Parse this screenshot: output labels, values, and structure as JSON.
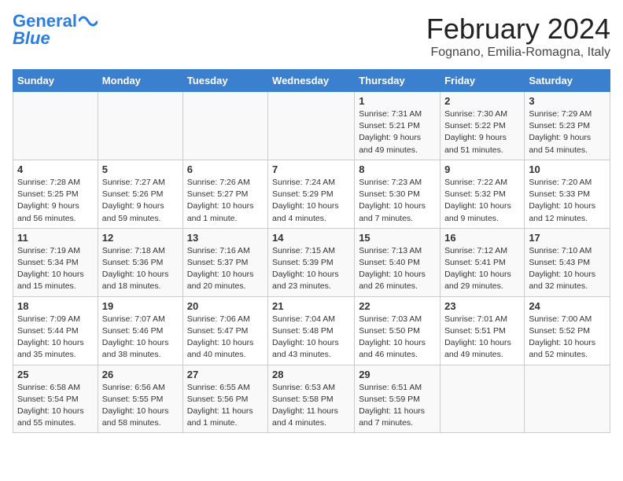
{
  "header": {
    "logo_line1": "General",
    "logo_line2": "Blue",
    "month_title": "February 2024",
    "location": "Fognano, Emilia-Romagna, Italy"
  },
  "days_of_week": [
    "Sunday",
    "Monday",
    "Tuesday",
    "Wednesday",
    "Thursday",
    "Friday",
    "Saturday"
  ],
  "weeks": [
    [
      {
        "day": "",
        "info": ""
      },
      {
        "day": "",
        "info": ""
      },
      {
        "day": "",
        "info": ""
      },
      {
        "day": "",
        "info": ""
      },
      {
        "day": "1",
        "info": "Sunrise: 7:31 AM\nSunset: 5:21 PM\nDaylight: 9 hours\nand 49 minutes."
      },
      {
        "day": "2",
        "info": "Sunrise: 7:30 AM\nSunset: 5:22 PM\nDaylight: 9 hours\nand 51 minutes."
      },
      {
        "day": "3",
        "info": "Sunrise: 7:29 AM\nSunset: 5:23 PM\nDaylight: 9 hours\nand 54 minutes."
      }
    ],
    [
      {
        "day": "4",
        "info": "Sunrise: 7:28 AM\nSunset: 5:25 PM\nDaylight: 9 hours\nand 56 minutes."
      },
      {
        "day": "5",
        "info": "Sunrise: 7:27 AM\nSunset: 5:26 PM\nDaylight: 9 hours\nand 59 minutes."
      },
      {
        "day": "6",
        "info": "Sunrise: 7:26 AM\nSunset: 5:27 PM\nDaylight: 10 hours\nand 1 minute."
      },
      {
        "day": "7",
        "info": "Sunrise: 7:24 AM\nSunset: 5:29 PM\nDaylight: 10 hours\nand 4 minutes."
      },
      {
        "day": "8",
        "info": "Sunrise: 7:23 AM\nSunset: 5:30 PM\nDaylight: 10 hours\nand 7 minutes."
      },
      {
        "day": "9",
        "info": "Sunrise: 7:22 AM\nSunset: 5:32 PM\nDaylight: 10 hours\nand 9 minutes."
      },
      {
        "day": "10",
        "info": "Sunrise: 7:20 AM\nSunset: 5:33 PM\nDaylight: 10 hours\nand 12 minutes."
      }
    ],
    [
      {
        "day": "11",
        "info": "Sunrise: 7:19 AM\nSunset: 5:34 PM\nDaylight: 10 hours\nand 15 minutes."
      },
      {
        "day": "12",
        "info": "Sunrise: 7:18 AM\nSunset: 5:36 PM\nDaylight: 10 hours\nand 18 minutes."
      },
      {
        "day": "13",
        "info": "Sunrise: 7:16 AM\nSunset: 5:37 PM\nDaylight: 10 hours\nand 20 minutes."
      },
      {
        "day": "14",
        "info": "Sunrise: 7:15 AM\nSunset: 5:39 PM\nDaylight: 10 hours\nand 23 minutes."
      },
      {
        "day": "15",
        "info": "Sunrise: 7:13 AM\nSunset: 5:40 PM\nDaylight: 10 hours\nand 26 minutes."
      },
      {
        "day": "16",
        "info": "Sunrise: 7:12 AM\nSunset: 5:41 PM\nDaylight: 10 hours\nand 29 minutes."
      },
      {
        "day": "17",
        "info": "Sunrise: 7:10 AM\nSunset: 5:43 PM\nDaylight: 10 hours\nand 32 minutes."
      }
    ],
    [
      {
        "day": "18",
        "info": "Sunrise: 7:09 AM\nSunset: 5:44 PM\nDaylight: 10 hours\nand 35 minutes."
      },
      {
        "day": "19",
        "info": "Sunrise: 7:07 AM\nSunset: 5:46 PM\nDaylight: 10 hours\nand 38 minutes."
      },
      {
        "day": "20",
        "info": "Sunrise: 7:06 AM\nSunset: 5:47 PM\nDaylight: 10 hours\nand 40 minutes."
      },
      {
        "day": "21",
        "info": "Sunrise: 7:04 AM\nSunset: 5:48 PM\nDaylight: 10 hours\nand 43 minutes."
      },
      {
        "day": "22",
        "info": "Sunrise: 7:03 AM\nSunset: 5:50 PM\nDaylight: 10 hours\nand 46 minutes."
      },
      {
        "day": "23",
        "info": "Sunrise: 7:01 AM\nSunset: 5:51 PM\nDaylight: 10 hours\nand 49 minutes."
      },
      {
        "day": "24",
        "info": "Sunrise: 7:00 AM\nSunset: 5:52 PM\nDaylight: 10 hours\nand 52 minutes."
      }
    ],
    [
      {
        "day": "25",
        "info": "Sunrise: 6:58 AM\nSunset: 5:54 PM\nDaylight: 10 hours\nand 55 minutes."
      },
      {
        "day": "26",
        "info": "Sunrise: 6:56 AM\nSunset: 5:55 PM\nDaylight: 10 hours\nand 58 minutes."
      },
      {
        "day": "27",
        "info": "Sunrise: 6:55 AM\nSunset: 5:56 PM\nDaylight: 11 hours\nand 1 minute."
      },
      {
        "day": "28",
        "info": "Sunrise: 6:53 AM\nSunset: 5:58 PM\nDaylight: 11 hours\nand 4 minutes."
      },
      {
        "day": "29",
        "info": "Sunrise: 6:51 AM\nSunset: 5:59 PM\nDaylight: 11 hours\nand 7 minutes."
      },
      {
        "day": "",
        "info": ""
      },
      {
        "day": "",
        "info": ""
      }
    ]
  ]
}
